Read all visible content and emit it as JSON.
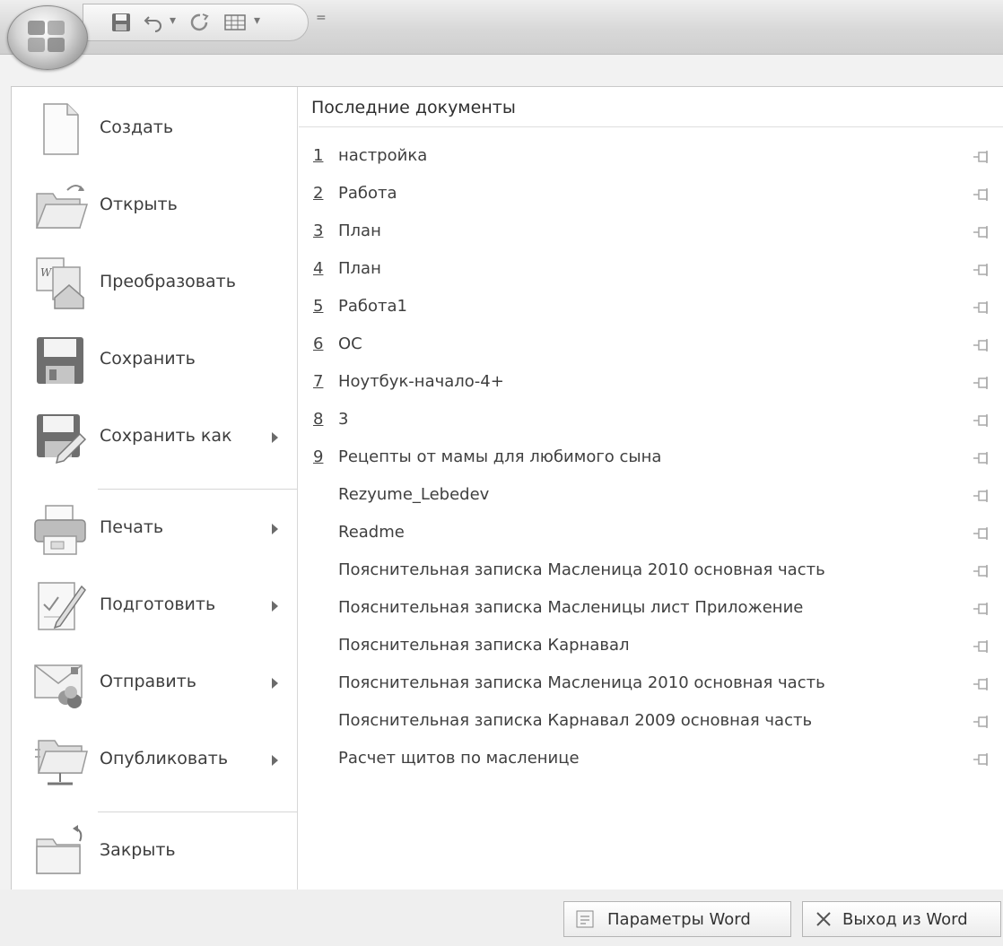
{
  "quick_access": {
    "icons": [
      "save-icon",
      "undo-icon",
      "redo-icon",
      "table-icon",
      "customize-dropdown-icon"
    ],
    "undo_arrow": "▾",
    "table_arrow": "▾",
    "customize_symbol": "="
  },
  "office_button": {
    "icon": "office-logo-icon"
  },
  "menu": {
    "items": [
      {
        "label": "Создать",
        "icon": "new-document-icon",
        "submenu": false
      },
      {
        "label": "Открыть",
        "icon": "open-folder-icon",
        "submenu": false
      },
      {
        "label": "Преобразовать",
        "icon": "convert-icon",
        "submenu": false
      },
      {
        "label": "Сохранить",
        "icon": "save-disk-icon",
        "submenu": false
      },
      {
        "label": "Сохранить как",
        "icon": "save-as-icon",
        "submenu": true
      },
      {
        "label": "Печать",
        "icon": "printer-icon",
        "submenu": true
      },
      {
        "label": "Подготовить",
        "icon": "prepare-icon",
        "submenu": true
      },
      {
        "label": "Отправить",
        "icon": "send-icon",
        "submenu": true
      },
      {
        "label": "Опубликовать",
        "icon": "publish-icon",
        "submenu": true
      },
      {
        "label": "Закрыть",
        "icon": "close-folder-icon",
        "submenu": false
      }
    ]
  },
  "recent": {
    "title": "Последние документы",
    "documents": [
      {
        "num": "1",
        "name": "настройка"
      },
      {
        "num": "2",
        "name": "Работа"
      },
      {
        "num": "3",
        "name": "План"
      },
      {
        "num": "4",
        "name": "План"
      },
      {
        "num": "5",
        "name": "Работа1"
      },
      {
        "num": "6",
        "name": "ОС"
      },
      {
        "num": "7",
        "name": "Ноутбук-начало-4+"
      },
      {
        "num": "8",
        "name": "3"
      },
      {
        "num": "9",
        "name": "Рецепты  от мамы для любимого сына"
      },
      {
        "num": "",
        "name": "Rezyume_Lebedev"
      },
      {
        "num": "",
        "name": "Readme"
      },
      {
        "num": "",
        "name": "Пояснительная записка Масленица 2010 основная часть"
      },
      {
        "num": "",
        "name": "Пояснительная записка Масленицы лист Приложение"
      },
      {
        "num": "",
        "name": "Пояснительная записка Карнавал"
      },
      {
        "num": "",
        "name": "Пояснительная записка Масленица 2010 основная часть"
      },
      {
        "num": "",
        "name": "Пояснительная записка Карнавал 2009 основная часть"
      },
      {
        "num": "",
        "name": "Расчет щитов по масленице"
      }
    ],
    "pin_icon": "pin-icon"
  },
  "footer": {
    "options_label": "Параметры Word",
    "exit_label": "Выход из Word"
  },
  "colors": {
    "panel_bg": "#ffffff",
    "frame_bg": "#f2f2f2",
    "text": "#3a3a3a",
    "separator": "#d6d6d6"
  }
}
